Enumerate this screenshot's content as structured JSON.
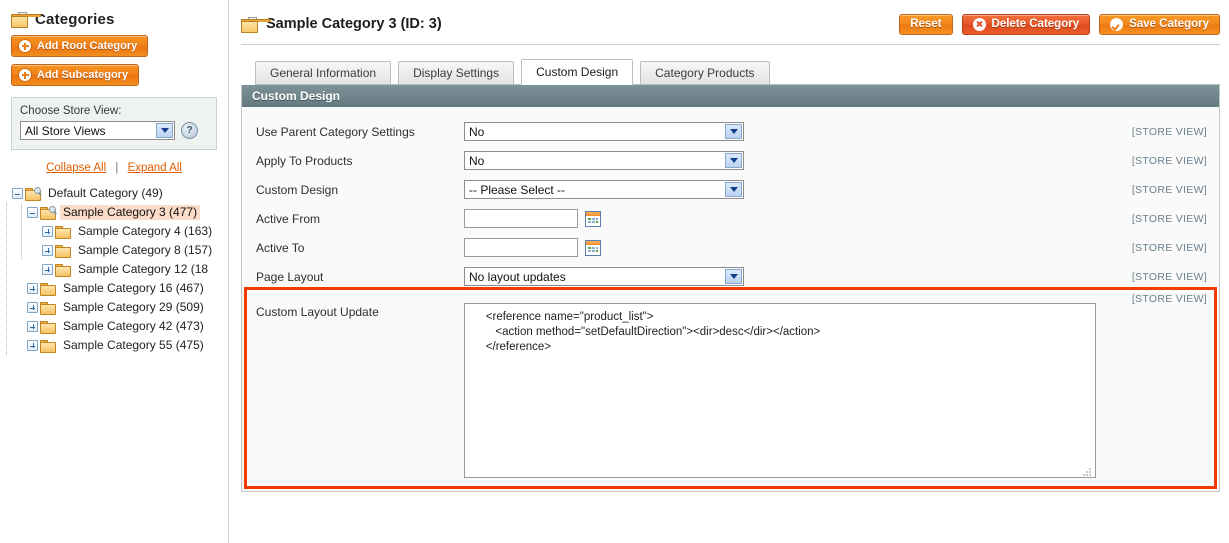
{
  "sidebar": {
    "title": "Categories",
    "add_root_label": "Add Root Category",
    "add_sub_label": "Add Subcategory",
    "store_label": "Choose Store View:",
    "store_value": "All Store Views",
    "help_glyph": "?",
    "collapse_all": "Collapse All",
    "expand_all": "Expand All",
    "separator": "|",
    "tree": [
      {
        "label": "Default Category (49)",
        "depth": 0,
        "expander": "minus",
        "icon": "folder-search",
        "selected": false
      },
      {
        "label": "Sample Category 3 (477)",
        "depth": 1,
        "expander": "minus",
        "icon": "folder-search",
        "selected": true
      },
      {
        "label": "Sample Category 4 (163)",
        "depth": 2,
        "expander": "plus",
        "icon": "folder",
        "selected": false
      },
      {
        "label": "Sample Category 8 (157)",
        "depth": 2,
        "expander": "plus",
        "icon": "folder",
        "selected": false
      },
      {
        "label": "Sample Category 12 (18",
        "depth": 2,
        "expander": "plus",
        "icon": "folder",
        "selected": false
      },
      {
        "label": "Sample Category 16 (467)",
        "depth": 1,
        "expander": "plus",
        "icon": "folder",
        "selected": false
      },
      {
        "label": "Sample Category 29 (509)",
        "depth": 1,
        "expander": "plus",
        "icon": "folder",
        "selected": false
      },
      {
        "label": "Sample Category 42 (473)",
        "depth": 1,
        "expander": "plus",
        "icon": "folder",
        "selected": false
      },
      {
        "label": "Sample Category 55 (475)",
        "depth": 1,
        "expander": "plus",
        "icon": "folder",
        "selected": false
      }
    ]
  },
  "header": {
    "title": "Sample Category 3 (ID: 3)",
    "reset_label": "Reset",
    "delete_label": "Delete Category",
    "save_label": "Save Category"
  },
  "tabs": [
    {
      "label": "General Information",
      "active": false
    },
    {
      "label": "Display Settings",
      "active": false
    },
    {
      "label": "Custom Design",
      "active": true
    },
    {
      "label": "Category Products",
      "active": false
    }
  ],
  "panel": {
    "title": "Custom Design",
    "scope_label": "[STORE VIEW]",
    "fields": [
      {
        "label": "Use Parent Category Settings",
        "type": "select",
        "value": "No"
      },
      {
        "label": "Apply To Products",
        "type": "select",
        "value": "No"
      },
      {
        "label": "Custom Design",
        "type": "select",
        "value": "-- Please Select --"
      },
      {
        "label": "Active From",
        "type": "date",
        "value": ""
      },
      {
        "label": "Active To",
        "type": "date",
        "value": ""
      },
      {
        "label": "Page Layout",
        "type": "select",
        "value": "No layout updates"
      }
    ],
    "layout_update": {
      "label": "Custom Layout Update",
      "value": "    <reference name=\"product_list\">\n       <action method=\"setDefaultDirection\"><dir>desc</dir></action>\n    </reference>"
    }
  },
  "colors": {
    "accent_orange": "#ef7f18",
    "delete_red": "#e0502a",
    "highlight_red": "#f13c00",
    "panel_header": "#6e838a",
    "scope_text": "#6a7f8c"
  }
}
